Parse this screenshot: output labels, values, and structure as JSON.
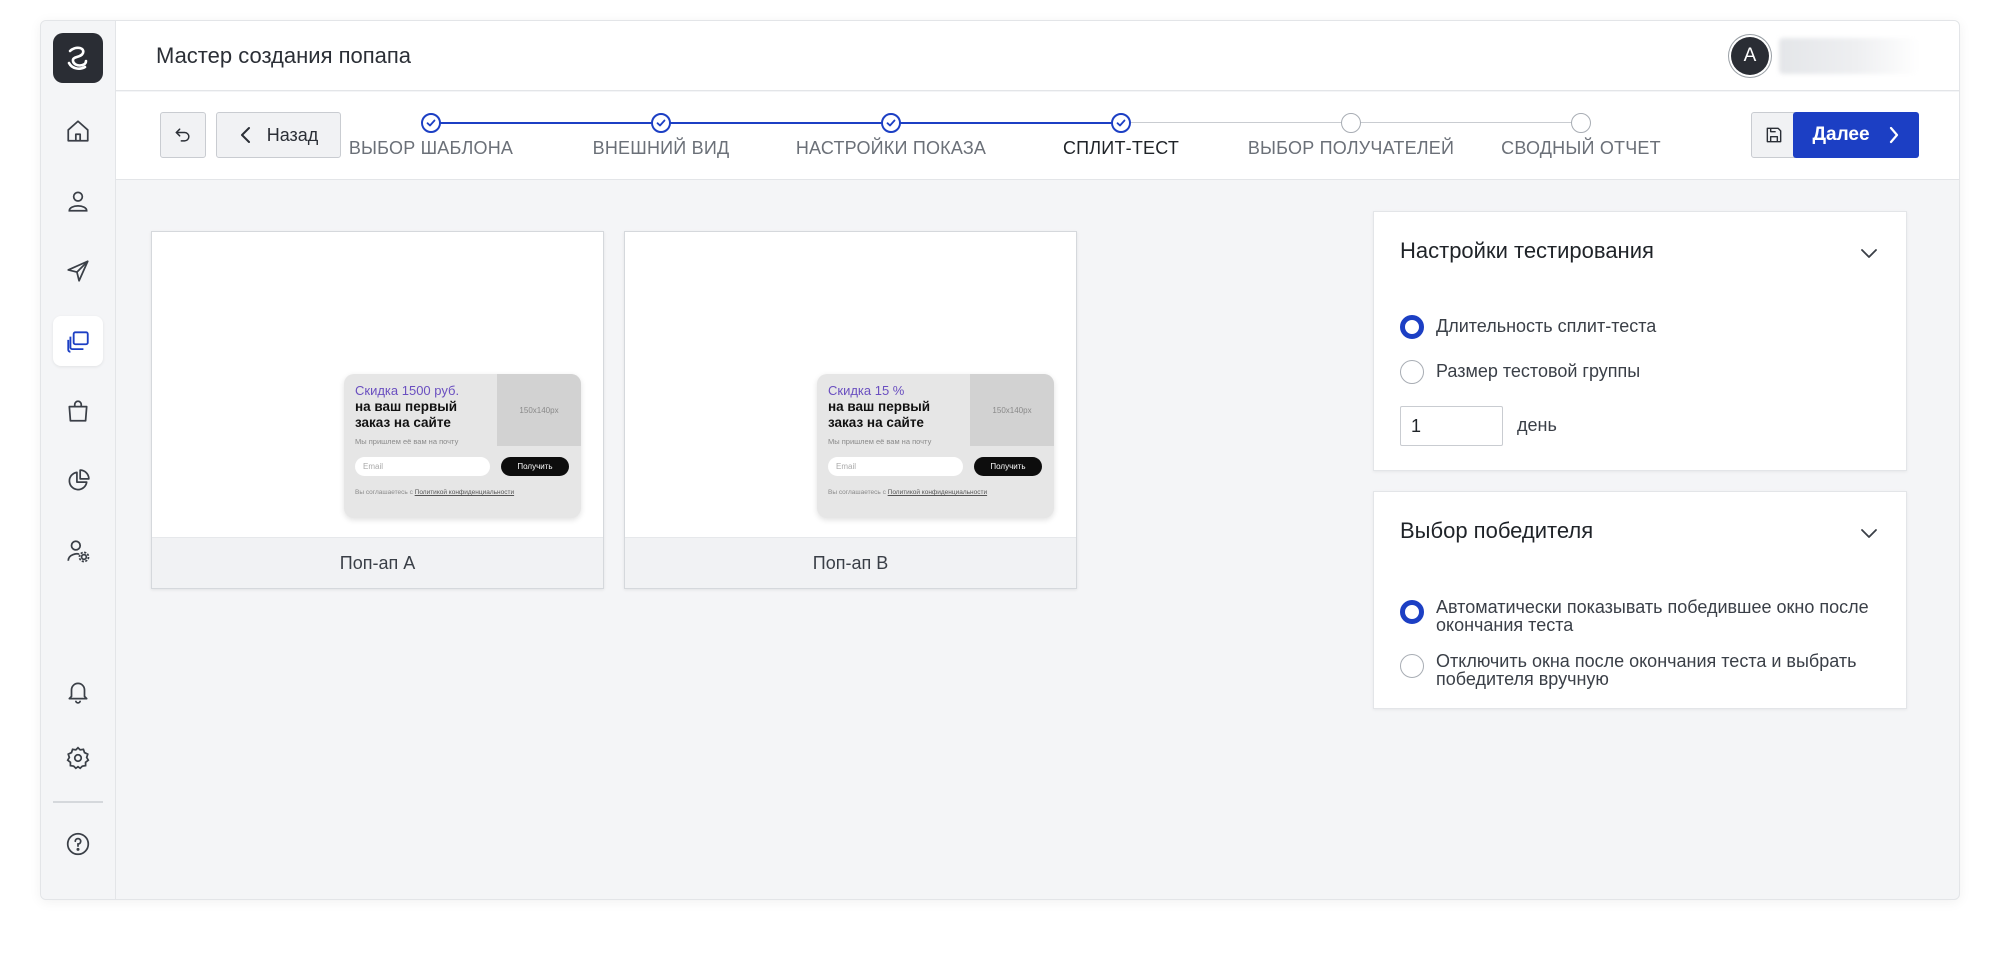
{
  "header": {
    "title": "Мастер создания попапа",
    "avatar_letter": "A"
  },
  "toolbar": {
    "back_label": "Назад",
    "next_label": "Далее"
  },
  "steps": [
    {
      "label": "ВЫБОР ШАБЛОНА",
      "status": "done"
    },
    {
      "label": "ВНЕШНИЙ ВИД",
      "status": "done"
    },
    {
      "label": "НАСТРОЙКИ ПОКАЗА",
      "status": "done"
    },
    {
      "label": "СПЛИТ-ТЕСТ",
      "status": "current"
    },
    {
      "label": "ВЫБОР ПОЛУЧАТЕЛЕЙ",
      "status": "todo"
    },
    {
      "label": "СВОДНЫЙ ОТЧЕТ",
      "status": "todo"
    }
  ],
  "sidebar": {
    "items": [
      {
        "icon": "home-icon"
      },
      {
        "icon": "user-icon"
      },
      {
        "icon": "send-icon"
      },
      {
        "icon": "popup-icon",
        "active": true
      },
      {
        "icon": "shopping-bag-icon"
      },
      {
        "icon": "pie-chart-icon"
      },
      {
        "icon": "user-settings-icon"
      },
      {
        "icon": "bell-icon"
      },
      {
        "icon": "gear-icon"
      },
      {
        "icon": "help-icon"
      }
    ]
  },
  "previews": [
    {
      "caption": "Поп-ап А",
      "promo": "Скидка 1500 руб.",
      "headline": "на ваш первый заказ на сайте",
      "sub": "Мы пришлем её вам на почту",
      "email_placeholder": "Email",
      "button": "Получить",
      "agree_prefix": "Вы соглашаетесь с ",
      "agree_link": "Политикой конфиденциальности",
      "image_size": "150x140px"
    },
    {
      "caption": "Поп-ап B",
      "promo": "Скидка 15 %",
      "headline": "на ваш первый заказ на сайте",
      "sub": "Мы пришлем её вам на почту",
      "email_placeholder": "Email",
      "button": "Получить",
      "agree_prefix": "Вы соглашаетесь с ",
      "agree_link": "Политикой конфиденциальности",
      "image_size": "150x140px"
    }
  ],
  "test_settings": {
    "title": "Настройки тестирования",
    "options": [
      "Длительность сплит-теста",
      "Размер тестовой группы"
    ],
    "selected_index": 0,
    "duration_value": "1",
    "duration_unit": "день"
  },
  "winner": {
    "title": "Выбор победителя",
    "options": [
      "Автоматически показывать победившее окно после окончания теста",
      "Отключить окна после окончания теста и выбрать победителя вручную"
    ],
    "selected_index": 0
  },
  "colors": {
    "accent": "#1c3fc4",
    "sidebar_bg": "#f4f5f7",
    "logo_bg": "#2a2d34",
    "promo_text": "#6a4fc0"
  }
}
